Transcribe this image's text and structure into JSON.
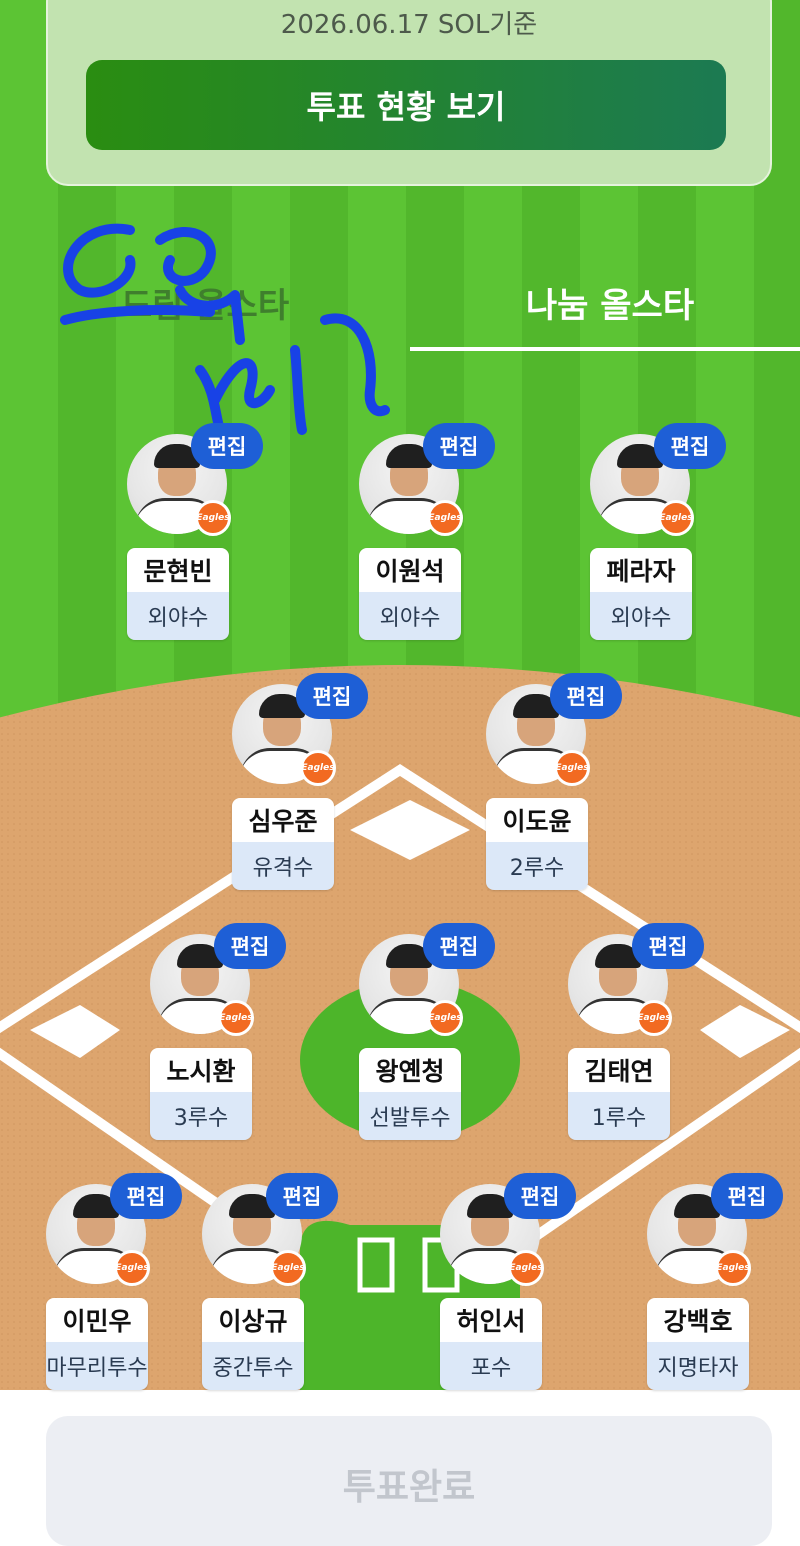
{
  "info": {
    "date": "2026.06.17 SOL기준",
    "status_button": "투표 현황 보기"
  },
  "tabs": [
    {
      "label": "드림 올스타",
      "active": false
    },
    {
      "label": "나눔 올스타",
      "active": true
    }
  ],
  "edit_label": "편집",
  "team_logo_text": "Eagles",
  "players": [
    {
      "name": "문현빈",
      "position": "외야수"
    },
    {
      "name": "이원석",
      "position": "외야수"
    },
    {
      "name": "페라자",
      "position": "외야수"
    },
    {
      "name": "심우준",
      "position": "유격수"
    },
    {
      "name": "이도윤",
      "position": "2루수"
    },
    {
      "name": "노시환",
      "position": "3루수"
    },
    {
      "name": "왕옌청",
      "position": "선발투수"
    },
    {
      "name": "김태연",
      "position": "1루수"
    },
    {
      "name": "이민우",
      "position": "마무리투수"
    },
    {
      "name": "이상규",
      "position": "중간투수"
    },
    {
      "name": "허인서",
      "position": "포수"
    },
    {
      "name": "강백호",
      "position": "지명타자"
    }
  ],
  "complete_button": "투표완료",
  "colors": {
    "accent": "#1e5fd6",
    "grass": "#5cc434",
    "dirt": "#dda56e",
    "team_orange": "#f26a21"
  }
}
